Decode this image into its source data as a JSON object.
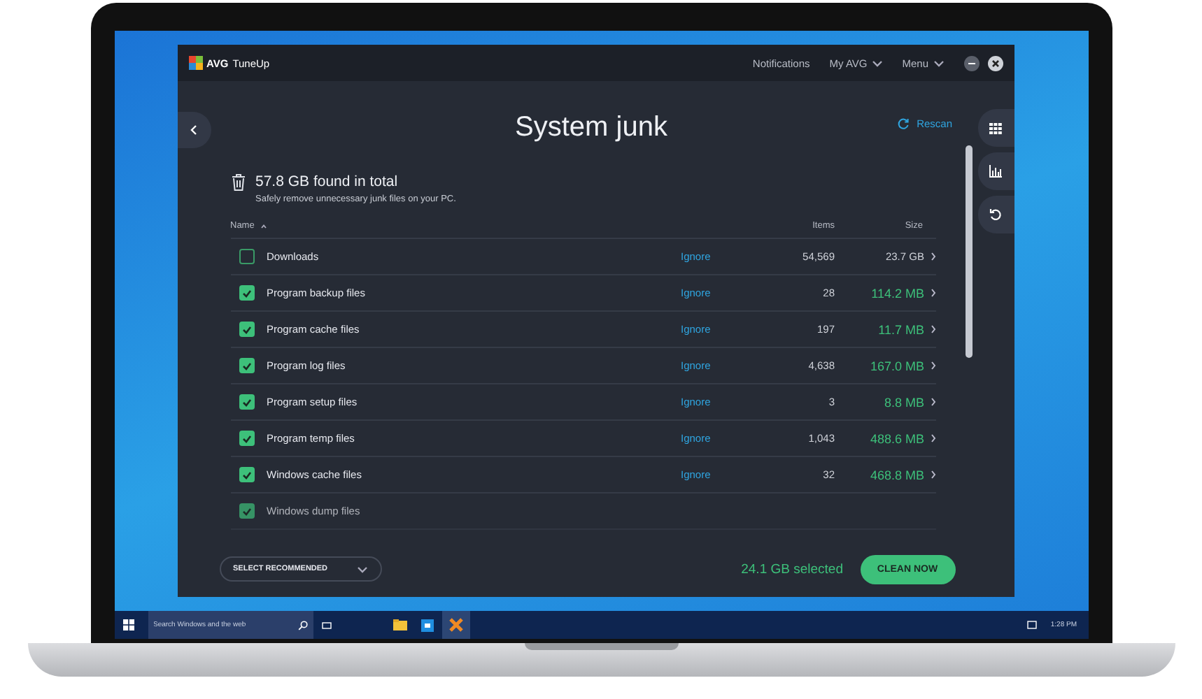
{
  "app": {
    "brand": "AVG",
    "product": "TuneUp",
    "nav": [
      {
        "label": "Notifications",
        "dropdown": false
      },
      {
        "label": "My AVG",
        "dropdown": true
      },
      {
        "label": "Menu",
        "dropdown": true
      }
    ]
  },
  "page": {
    "title": "System junk",
    "rescan": "Rescan",
    "total": "57.8 GB found in total",
    "subtitle": "Safely remove unnecessary junk files on your PC."
  },
  "table": {
    "columns": [
      "Name",
      "Items",
      "Size"
    ],
    "rows": [
      {
        "name": "Downloads",
        "checked": false,
        "ignore": "Ignore",
        "items": "54,569",
        "size": "23.7 GB"
      },
      {
        "name": "Program backup files",
        "checked": true,
        "ignore": "Ignore",
        "items": "28",
        "size": "114.2 MB"
      },
      {
        "name": "Program cache files",
        "checked": true,
        "ignore": "Ignore",
        "items": "197",
        "size": "11.7 MB"
      },
      {
        "name": "Program log files",
        "checked": true,
        "ignore": "Ignore",
        "items": "4,638",
        "size": "167.0 MB"
      },
      {
        "name": "Program setup files",
        "checked": true,
        "ignore": "Ignore",
        "items": "3",
        "size": "8.8 MB"
      },
      {
        "name": "Program temp files",
        "checked": true,
        "ignore": "Ignore",
        "items": "1,043",
        "size": "488.6 MB"
      },
      {
        "name": "Windows cache files",
        "checked": true,
        "ignore": "Ignore",
        "items": "32",
        "size": "468.8 MB"
      },
      {
        "name": "Windows dump files",
        "checked": true
      }
    ]
  },
  "footer": {
    "select": "SELECT RECOMMENDED",
    "selected": "24.1 GB selected",
    "clean": "CLEAN NOW"
  },
  "taskbar": {
    "search_placeholder": "Search Windows and the web",
    "time": "1:28 PM"
  }
}
